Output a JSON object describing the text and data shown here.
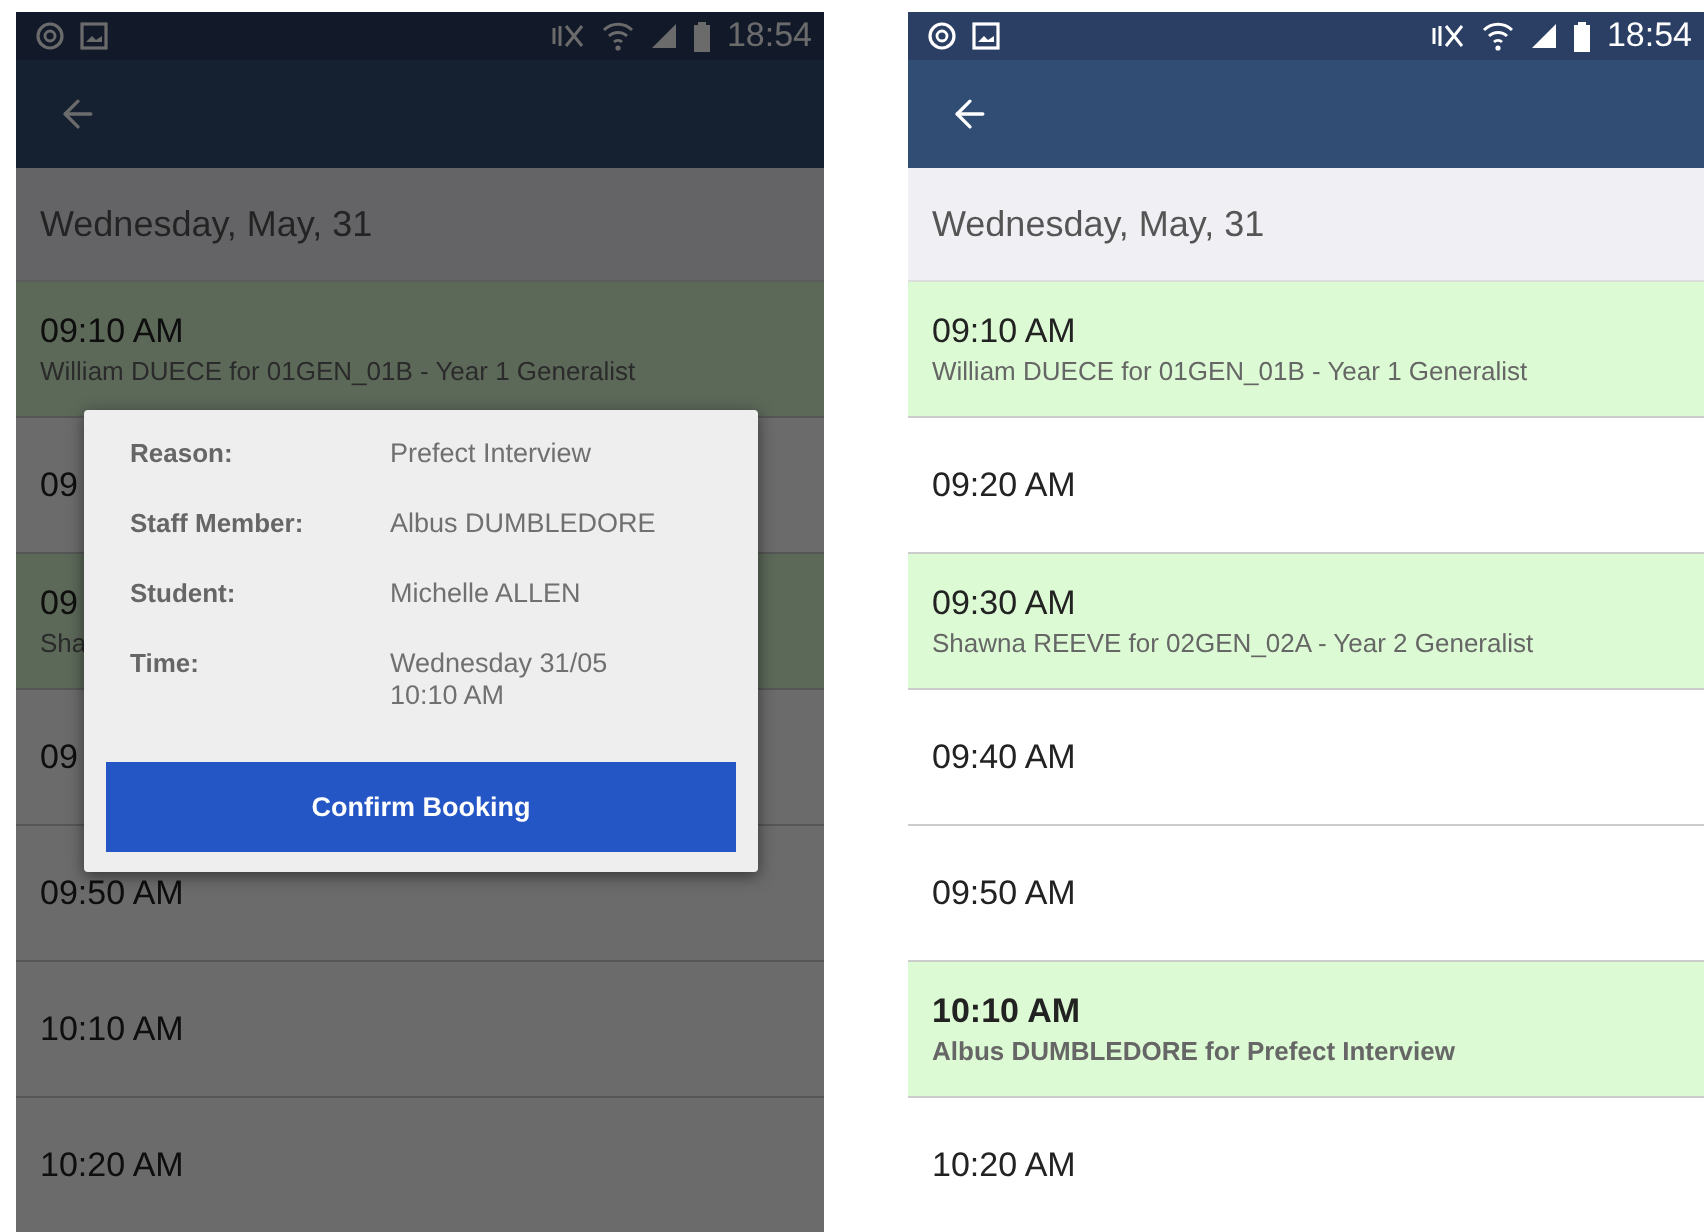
{
  "screens": [
    {
      "dimmed": true,
      "status_bar": {
        "time": "18:54"
      },
      "date_header": "Wednesday, May, 31",
      "slots": [
        {
          "time": "09:10 AM",
          "detail": "William DUECE for 01GEN_01B - Year 1 Generalist",
          "booked": true,
          "emphasized": false
        },
        {
          "time": "09",
          "booked": false,
          "emphasized": false
        },
        {
          "time": "09",
          "detail": "Sha",
          "booked": true,
          "emphasized": false
        },
        {
          "time": "09",
          "booked": false,
          "emphasized": false
        },
        {
          "time": "09:50 AM",
          "booked": false,
          "emphasized": false
        },
        {
          "time": "10:10 AM",
          "booked": false,
          "emphasized": false
        },
        {
          "time": "10:20 AM",
          "booked": false,
          "emphasized": false
        }
      ],
      "dialog": {
        "fields": [
          {
            "label": "Reason:",
            "value": "Prefect Interview"
          },
          {
            "label": "Staff Member:",
            "value": "Albus DUMBLEDORE"
          },
          {
            "label": "Student:",
            "value": "Michelle ALLEN"
          },
          {
            "label": "Time:",
            "value": "Wednesday 31/05\n10:10 AM"
          }
        ],
        "button": "Confirm Booking"
      }
    },
    {
      "dimmed": false,
      "status_bar": {
        "time": "18:54"
      },
      "date_header": "Wednesday, May, 31",
      "slots": [
        {
          "time": "09:10 AM",
          "detail": "William DUECE for 01GEN_01B - Year 1 Generalist",
          "booked": true,
          "emphasized": false
        },
        {
          "time": "09:20 AM",
          "booked": false,
          "emphasized": false
        },
        {
          "time": "09:30 AM",
          "detail": "Shawna REEVE for 02GEN_02A - Year 2 Generalist",
          "booked": true,
          "emphasized": false
        },
        {
          "time": "09:40 AM",
          "booked": false,
          "emphasized": false
        },
        {
          "time": "09:50 AM",
          "booked": false,
          "emphasized": false
        },
        {
          "time": "10:10 AM",
          "detail": "Albus DUMBLEDORE for Prefect Interview",
          "booked": true,
          "emphasized": true
        },
        {
          "time": "10:20 AM",
          "booked": false,
          "emphasized": false
        }
      ]
    }
  ]
}
